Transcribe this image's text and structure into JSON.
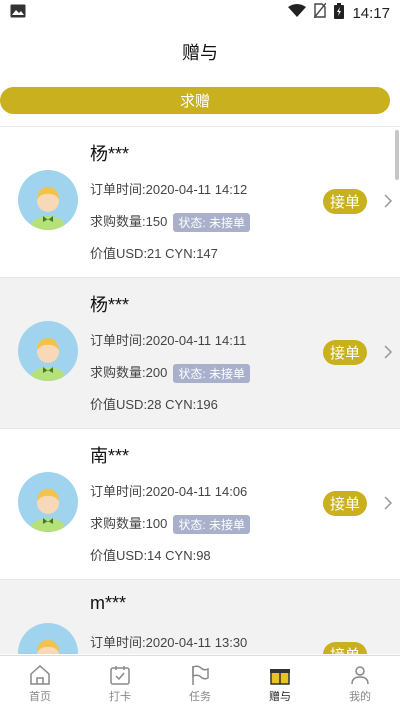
{
  "status_bar": {
    "time": "14:17"
  },
  "header": {
    "title": "赠与"
  },
  "request_button": {
    "label": "求赠"
  },
  "orders": [
    {
      "user": "杨***",
      "order_time": "订单时间:2020-04-11 14:12",
      "quantity": "求购数量:150",
      "status": "状态: 未接单",
      "value": "价值USD:21 CYN:147",
      "action": "接单"
    },
    {
      "user": "杨***",
      "order_time": "订单时间:2020-04-11 14:11",
      "quantity": "求购数量:200",
      "status": "状态: 未接单",
      "value": "价值USD:28 CYN:196",
      "action": "接单"
    },
    {
      "user": "南***",
      "order_time": "订单时间:2020-04-11 14:06",
      "quantity": "求购数量:100",
      "status": "状态: 未接单",
      "value": "价值USD:14 CYN:98",
      "action": "接单"
    },
    {
      "user": "m***",
      "order_time": "订单时间:2020-04-11 13:30",
      "quantity": "",
      "status": "",
      "value": "",
      "action": "接单"
    }
  ],
  "tabs": [
    {
      "label": "首页",
      "icon": "home-icon"
    },
    {
      "label": "打卡",
      "icon": "checkin-icon"
    },
    {
      "label": "任务",
      "icon": "flag-icon"
    },
    {
      "label": "赠与",
      "icon": "gift-icon",
      "active": true
    },
    {
      "label": "我的",
      "icon": "profile-icon"
    }
  ],
  "colors": {
    "accent": "#c8b01e",
    "status_badge": "#a8b0cc"
  }
}
